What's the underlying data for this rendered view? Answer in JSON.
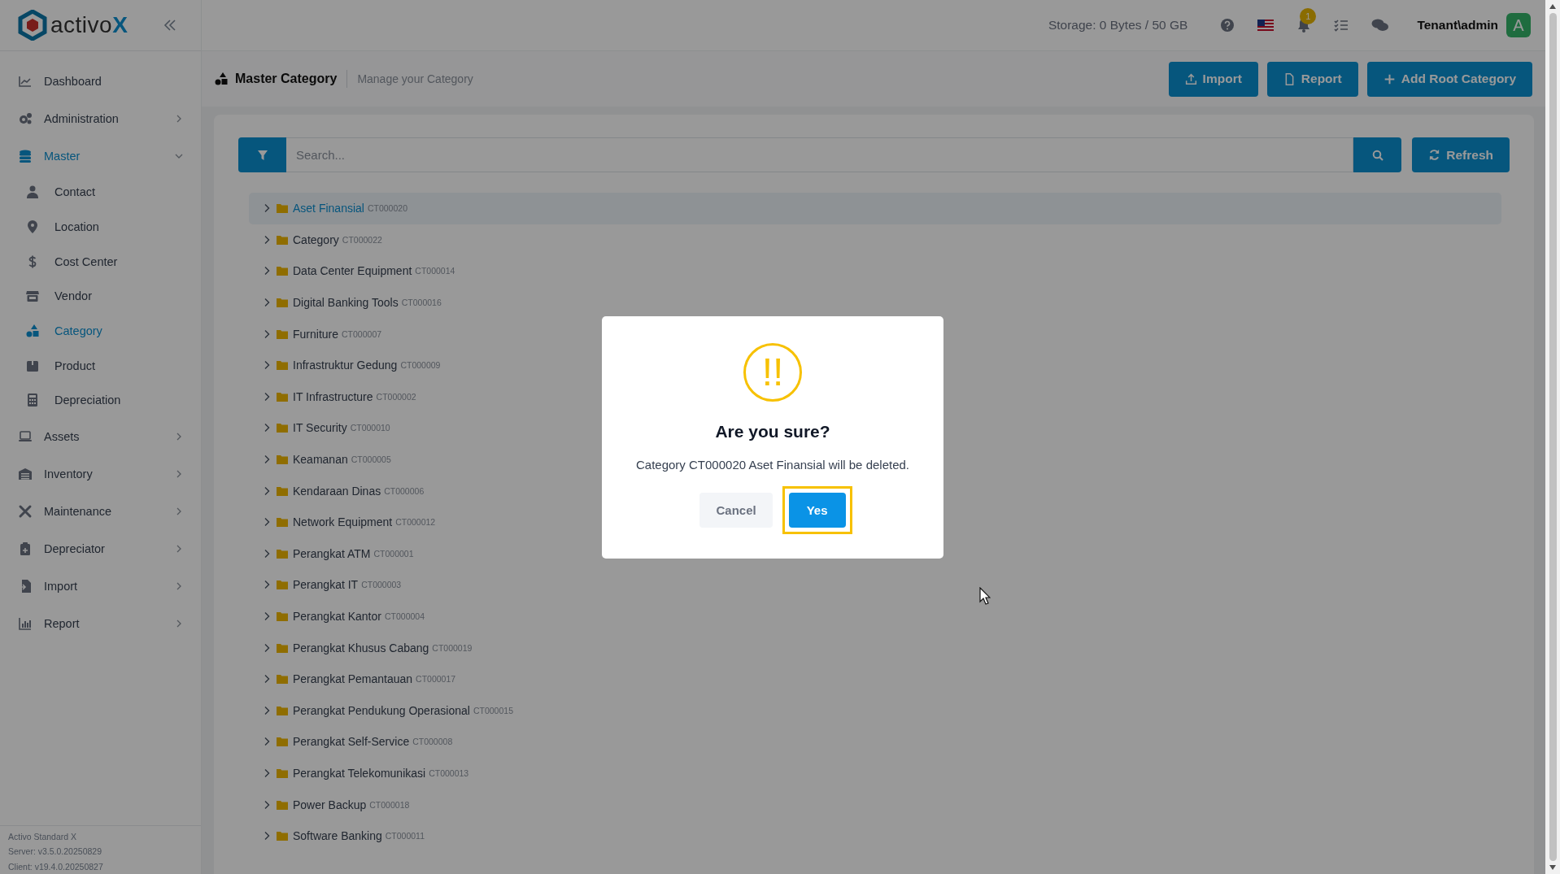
{
  "brand": {
    "name": "activo",
    "accent": "X"
  },
  "sidebar": {
    "items": [
      {
        "label": "Dashboard",
        "kind": "link",
        "active": false
      },
      {
        "label": "Administration",
        "kind": "group",
        "active": false,
        "expanded": false
      },
      {
        "label": "Master",
        "kind": "group",
        "active": true,
        "expanded": true,
        "children": [
          {
            "label": "Contact",
            "selected": false
          },
          {
            "label": "Location",
            "selected": false
          },
          {
            "label": "Cost Center",
            "selected": false
          },
          {
            "label": "Vendor",
            "selected": false
          },
          {
            "label": "Category",
            "selected": true
          },
          {
            "label": "Product",
            "selected": false
          },
          {
            "label": "Depreciation",
            "selected": false
          }
        ]
      },
      {
        "label": "Assets",
        "kind": "group",
        "active": false,
        "expanded": false
      },
      {
        "label": "Inventory",
        "kind": "group",
        "active": false,
        "expanded": false
      },
      {
        "label": "Maintenance",
        "kind": "group",
        "active": false,
        "expanded": false
      },
      {
        "label": "Depreciator",
        "kind": "group",
        "active": false,
        "expanded": false
      },
      {
        "label": "Import",
        "kind": "group",
        "active": false,
        "expanded": false
      },
      {
        "label": "Report",
        "kind": "group",
        "active": false,
        "expanded": false
      }
    ],
    "footer": [
      "Activo Standard X",
      "Server: v3.5.0.20250829",
      "Client: v19.4.0.20250827"
    ]
  },
  "topbar": {
    "storage": "Storage: 0 Bytes / 50 GB",
    "notification_count": "1",
    "user": "Tenant\\admin",
    "avatar": "A"
  },
  "page": {
    "title": "Master Category",
    "subtitle": "Manage your Category",
    "buttons": [
      "Import",
      "Report",
      "Add Root Category"
    ]
  },
  "search": {
    "placeholder": "Search...",
    "refresh": "Refresh"
  },
  "tree": [
    {
      "name": "Aset Finansial",
      "code": "CT000020",
      "selected": true
    },
    {
      "name": "Category",
      "code": "CT000022",
      "selected": false
    },
    {
      "name": "Data Center Equipment",
      "code": "CT000014",
      "selected": false
    },
    {
      "name": "Digital Banking Tools",
      "code": "CT000016",
      "selected": false
    },
    {
      "name": "Furniture",
      "code": "CT000007",
      "selected": false
    },
    {
      "name": "Infrastruktur Gedung",
      "code": "CT000009",
      "selected": false
    },
    {
      "name": "IT Infrastructure",
      "code": "CT000002",
      "selected": false
    },
    {
      "name": "IT Security",
      "code": "CT000010",
      "selected": false
    },
    {
      "name": "Keamanan",
      "code": "CT000005",
      "selected": false
    },
    {
      "name": "Kendaraan Dinas",
      "code": "CT000006",
      "selected": false
    },
    {
      "name": "Network Equipment",
      "code": "CT000012",
      "selected": false
    },
    {
      "name": "Perangkat ATM",
      "code": "CT000001",
      "selected": false
    },
    {
      "name": "Perangkat IT",
      "code": "CT000003",
      "selected": false
    },
    {
      "name": "Perangkat Kantor",
      "code": "CT000004",
      "selected": false
    },
    {
      "name": "Perangkat Khusus Cabang",
      "code": "CT000019",
      "selected": false
    },
    {
      "name": "Perangkat Pemantauan",
      "code": "CT000017",
      "selected": false
    },
    {
      "name": "Perangkat Pendukung Operasional",
      "code": "CT000015",
      "selected": false
    },
    {
      "name": "Perangkat Self-Service",
      "code": "CT000008",
      "selected": false
    },
    {
      "name": "Perangkat Telekomunikasi",
      "code": "CT000013",
      "selected": false
    },
    {
      "name": "Power Backup",
      "code": "CT000018",
      "selected": false
    },
    {
      "name": "Software Banking",
      "code": "CT000011",
      "selected": false
    }
  ],
  "dialog": {
    "icon_text": "!!",
    "title": "Are you sure?",
    "message": "Category CT000020 Aset Finansial will be deleted.",
    "buttons": [
      {
        "label": "Cancel",
        "kind": "cancel",
        "focused": false
      },
      {
        "label": "Yes",
        "kind": "confirm",
        "focused": true
      }
    ]
  }
}
